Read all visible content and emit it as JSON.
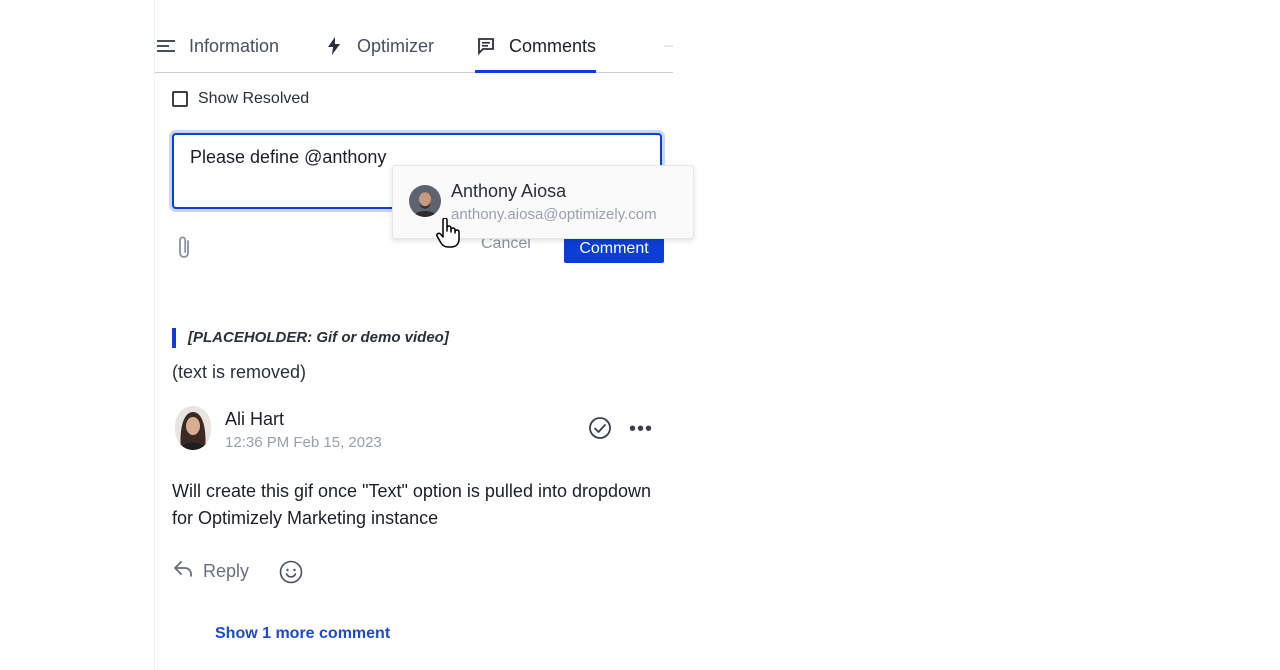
{
  "tabs": [
    {
      "label": "Information",
      "icon": "lines-icon"
    },
    {
      "label": "Optimizer",
      "icon": "lightning-icon"
    },
    {
      "label": "Comments",
      "icon": "comment-icon",
      "active": true
    }
  ],
  "filters": {
    "show_resolved_label": "Show Resolved",
    "show_resolved_checked": false
  },
  "composer": {
    "value": "Please define @anthony",
    "cancel_label": "Cancel",
    "submit_label": "Comment"
  },
  "mention": {
    "name": "Anthony Aiosa",
    "email": "anthony.aiosa@optimizely.com"
  },
  "thread": {
    "placeholder": "[PLACEHOLDER: Gif or demo video]",
    "removed_note": "(text is removed)",
    "comment": {
      "author": "Ali Hart",
      "timestamp": "12:36 PM Feb 15, 2023",
      "body": "Will create this gif once \"Text\" option is pulled into dropdown for Optimizely Marketing instance"
    },
    "reply_label": "Reply",
    "more_label": "Show 1 more comment"
  },
  "colors": {
    "accent": "#0b3ed6",
    "link": "#1d4bc8"
  }
}
